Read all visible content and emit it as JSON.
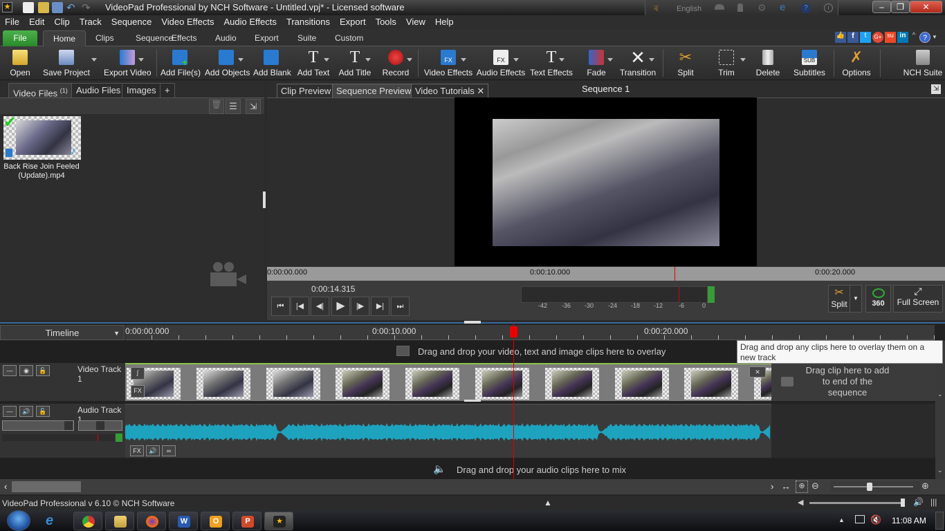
{
  "window": {
    "title": "VideoPad Professional by NCH Software - Untitled.vpj* - Licensed software",
    "language": "English",
    "controls": [
      "minimize",
      "restore",
      "close"
    ]
  },
  "menubar": [
    "File",
    "Edit",
    "Clip",
    "Track",
    "Sequence",
    "Video Effects",
    "Audio Effects",
    "Transitions",
    "Export",
    "Tools",
    "View",
    "Help"
  ],
  "ribbon_tabs": [
    {
      "label": "File",
      "style": "file"
    },
    {
      "label": "Home",
      "active": true
    },
    {
      "label": "Clips"
    },
    {
      "label": "Sequence"
    },
    {
      "label": "Effects"
    },
    {
      "label": "Audio"
    },
    {
      "label": "Export"
    },
    {
      "label": "Suite"
    },
    {
      "label": "Custom"
    }
  ],
  "social_icons": [
    "like-icon",
    "facebook-icon",
    "twitter-icon",
    "google-plus-icon",
    "stumbleupon-icon",
    "linkedin-icon",
    "help-icon"
  ],
  "toolbar": [
    {
      "label": "Open",
      "icon": "folder-open-icon"
    },
    {
      "label": "Save Project",
      "icon": "save-icon",
      "dropdown": true
    },
    {
      "label": "Export Video",
      "icon": "export-video-icon",
      "dropdown": true
    },
    {
      "label": "Add File(s)",
      "icon": "add-file-icon"
    },
    {
      "label": "Add Objects",
      "icon": "add-objects-icon",
      "dropdown": true
    },
    {
      "label": "Add Blank",
      "icon": "add-blank-icon"
    },
    {
      "label": "Add Text",
      "icon": "add-text-icon",
      "dropdown": true
    },
    {
      "label": "Add Title",
      "icon": "add-title-icon",
      "dropdown": true
    },
    {
      "label": "Record",
      "icon": "record-icon",
      "dropdown": true
    },
    {
      "label": "Video Effects",
      "icon": "video-fx-icon",
      "dropdown": true
    },
    {
      "label": "Audio Effects",
      "icon": "audio-fx-icon",
      "dropdown": true
    },
    {
      "label": "Text Effects",
      "icon": "text-effects-icon",
      "dropdown": true
    },
    {
      "label": "Fade",
      "icon": "fade-icon",
      "dropdown": true
    },
    {
      "label": "Transition",
      "icon": "transition-icon",
      "dropdown": true
    },
    {
      "label": "Split",
      "icon": "scissors-icon"
    },
    {
      "label": "Trim",
      "icon": "trim-icon",
      "dropdown": true
    },
    {
      "label": "Delete",
      "icon": "trash-icon"
    },
    {
      "label": "Subtitles",
      "icon": "subtitles-icon"
    },
    {
      "label": "Options",
      "icon": "options-icon"
    },
    {
      "label": "NCH Suite",
      "icon": "nch-suite-icon"
    }
  ],
  "bin": {
    "tabs": [
      {
        "label": "Video Files",
        "count": "(1)",
        "active": true
      },
      {
        "label": "Audio Files"
      },
      {
        "label": "Images"
      },
      {
        "label": "+"
      }
    ],
    "files": [
      {
        "name": "Back Rise Join Feeled (Update).mp4",
        "checked": true
      }
    ]
  },
  "preview": {
    "tabs": [
      {
        "label": "Clip Preview"
      },
      {
        "label": "Sequence Preview",
        "active": true
      },
      {
        "label": "Video Tutorials",
        "closable": true
      }
    ],
    "sequence_title": "Sequence 1",
    "ruler_labels": [
      "0:00:00.000",
      "0:00:10.000",
      "0:00:20.000"
    ],
    "current_time": "0:00:14.315",
    "transport": [
      "go-to-start",
      "previous-clip",
      "step-back",
      "play",
      "step-forward",
      "next-clip",
      "go-to-end"
    ],
    "meter_scale": [
      "-42",
      "-36",
      "-30",
      "-24",
      "-18",
      "-12",
      "-6",
      "0"
    ],
    "right_buttons": {
      "split": "Split",
      "vr360": "360",
      "fullscreen": "Full Screen"
    }
  },
  "timeline": {
    "header": "Timeline",
    "ruler_labels": [
      "0:00:00.000",
      "0:00:10.000",
      "0:00:20.000"
    ],
    "overlay_hint": "Drag and drop your video, text and image clips here to overlay",
    "video_track": {
      "name": "Video Track 1",
      "clip_count": 10
    },
    "add_to_end_hint": "Drag clip here to add to end of the sequence",
    "audio_track": {
      "name": "Audio Track 1"
    },
    "mix_hint": "Drag and drop your audio clips here to mix",
    "tooltip": "Drag and drop any clips here to overlay them on a new track",
    "playhead_time": "0:00:14.315"
  },
  "status": {
    "text": "VideoPad Professional v 6.10 © NCH Software"
  },
  "taskbar": {
    "apps": [
      "internet-explorer",
      "chrome",
      "file-explorer",
      "firefox",
      "word",
      "outlook",
      "powerpoint",
      "videopad"
    ],
    "clock": "11:08 AM"
  },
  "colors": {
    "accent_green": "#3a9a3a",
    "waveform": "#1ea3bf",
    "playhead": "#dd0000",
    "timeline_border": "#3a6aa0"
  }
}
